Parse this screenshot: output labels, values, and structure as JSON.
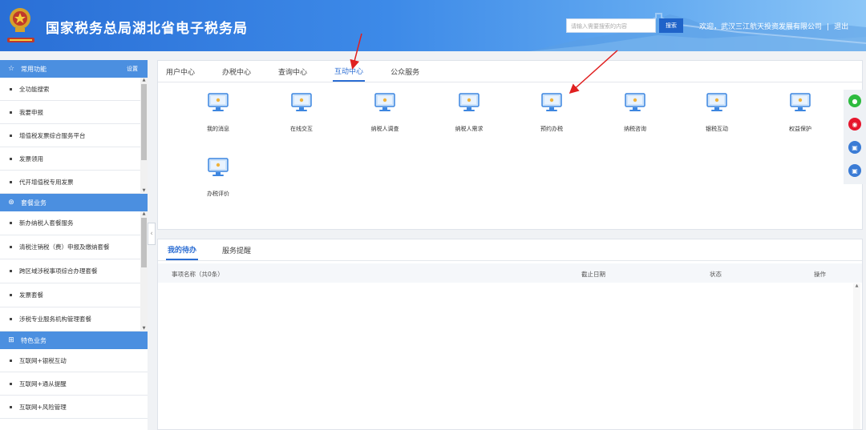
{
  "header": {
    "title": "国家税务总局湖北省电子税务局",
    "search_placeholder": "请输入需要搜索的内容",
    "search_button": "搜索",
    "welcome_text": "欢迎，武汉三江航天投资发展有限公司",
    "separator": "|",
    "logout": "退出"
  },
  "sidebar": {
    "sections": [
      {
        "title": "常用功能",
        "icon": "star-icon",
        "action": "设置",
        "items": [
          "全功能搜索",
          "我要申报",
          "增值税发票综合服务平台",
          "发票领用",
          "代开增值税专用发票"
        ]
      },
      {
        "title": "套餐业务",
        "icon": "package-icon",
        "items": [
          "新办纳税人套餐服务",
          "清税注销税（费）申报及缴纳套餐",
          "跨区域涉税事项综合办理套餐",
          "发票套餐",
          "涉税专业服务机构管理套餐"
        ]
      },
      {
        "title": "特色业务",
        "icon": "grid-icon",
        "items": [
          "互联网+银税互动",
          "互联网+通从提醒",
          "互联网+风险管理"
        ]
      }
    ],
    "collapse_glyph": "‹"
  },
  "main_tabs": {
    "items": [
      "用户中心",
      "办税中心",
      "查询中心",
      "互动中心",
      "公众服务"
    ],
    "active": "互动中心"
  },
  "services": {
    "icon": "monitor-icon",
    "items": [
      "我的消息",
      "在线交互",
      "纳税人调查",
      "纳税人需求",
      "预约办税",
      "纳税咨询",
      "银税互动",
      "权益保护",
      "办税评价"
    ]
  },
  "floating_tools": [
    {
      "icon": "wechat-icon",
      "color": "#2dbb3f",
      "glyph": "●"
    },
    {
      "icon": "weibo-icon",
      "color": "#e6162d",
      "glyph": "◉"
    },
    {
      "icon": "app-icon",
      "color": "#3a7bd5",
      "glyph": "▣"
    },
    {
      "icon": "app-icon-2",
      "color": "#3a7bd5",
      "glyph": "▣"
    }
  ],
  "todo_panel": {
    "tabs": [
      "我的待办",
      "服务提醒"
    ],
    "active_tab": "我的待办",
    "columns": {
      "name": "事项名称（共0条）",
      "deadline": "截止日期",
      "status": "状态",
      "action": "操作"
    }
  },
  "colors": {
    "brand_blue": "#2b6dd3",
    "sidebar_head": "#4b8fe0",
    "annotation_red": "#e02020"
  }
}
